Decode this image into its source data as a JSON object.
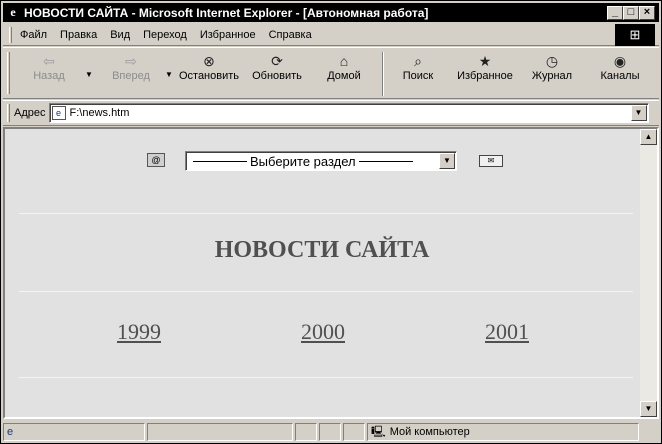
{
  "window": {
    "title": "НОВОСТИ САЙТА - Microsoft Internet Explorer - [Автономная работа]"
  },
  "menu": [
    {
      "label": "Файл"
    },
    {
      "label": "Правка"
    },
    {
      "label": "Вид"
    },
    {
      "label": "Переход"
    },
    {
      "label": "Избранное"
    },
    {
      "label": "Справка"
    }
  ],
  "toolbar": {
    "back": {
      "label": "Назад",
      "icon": "back-arrow-icon",
      "enabled": false
    },
    "forward": {
      "label": "Вперед",
      "icon": "forward-arrow-icon",
      "enabled": false
    },
    "stop": {
      "label": "Остановить",
      "icon": "stop-icon"
    },
    "refresh": {
      "label": "Обновить",
      "icon": "refresh-icon"
    },
    "home": {
      "label": "Домой",
      "icon": "home-icon"
    },
    "search": {
      "label": "Поиск",
      "icon": "search-icon"
    },
    "favorites": {
      "label": "Избранное",
      "icon": "favorites-icon"
    },
    "history": {
      "label": "Журнал",
      "icon": "history-icon"
    },
    "channels": {
      "label": "Каналы",
      "icon": "channels-icon"
    }
  },
  "address": {
    "label": "Адрес",
    "value": "F:\\news.htm"
  },
  "page": {
    "select_placeholder": "Выберите раздел",
    "title": "НОВОСТИ САЙТА",
    "years": [
      "1999",
      "2000",
      "2001"
    ]
  },
  "status": {
    "zone": "Мой компьютер"
  }
}
